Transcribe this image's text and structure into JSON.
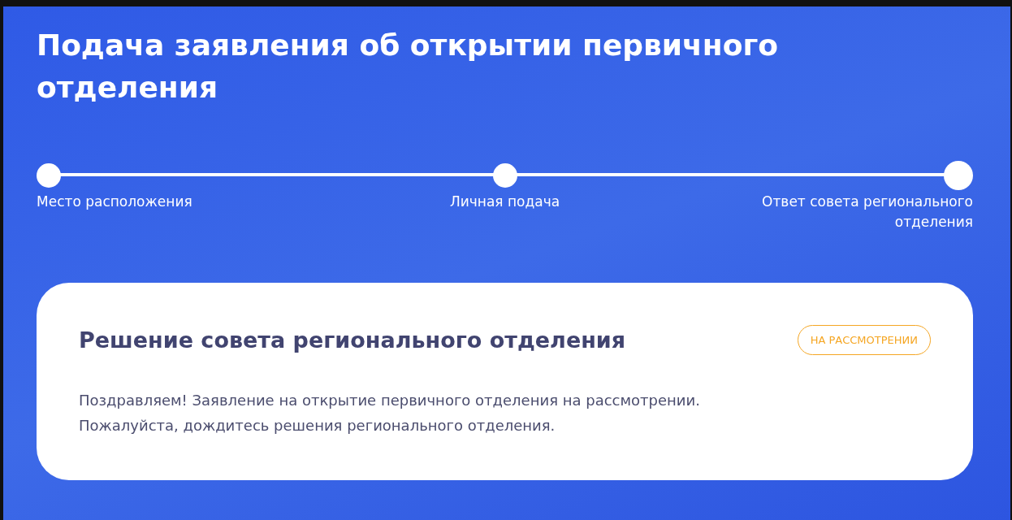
{
  "title": "Подача заявления об открытии первичного отделения",
  "steps": [
    {
      "label": "Место расположения",
      "selected": false
    },
    {
      "label": "Личная подача",
      "selected": false
    },
    {
      "label": "Ответ совета регионального отделения",
      "selected": true
    }
  ],
  "card": {
    "title": "Решение совета регионального отделения",
    "status": "НА РАССМОТРЕНИИ",
    "lines": [
      "Поздравляем! Заявление на открытие первичного отделения на рассмотрении.",
      "Пожалуйста, дождитесь решения регионального отделения."
    ]
  }
}
